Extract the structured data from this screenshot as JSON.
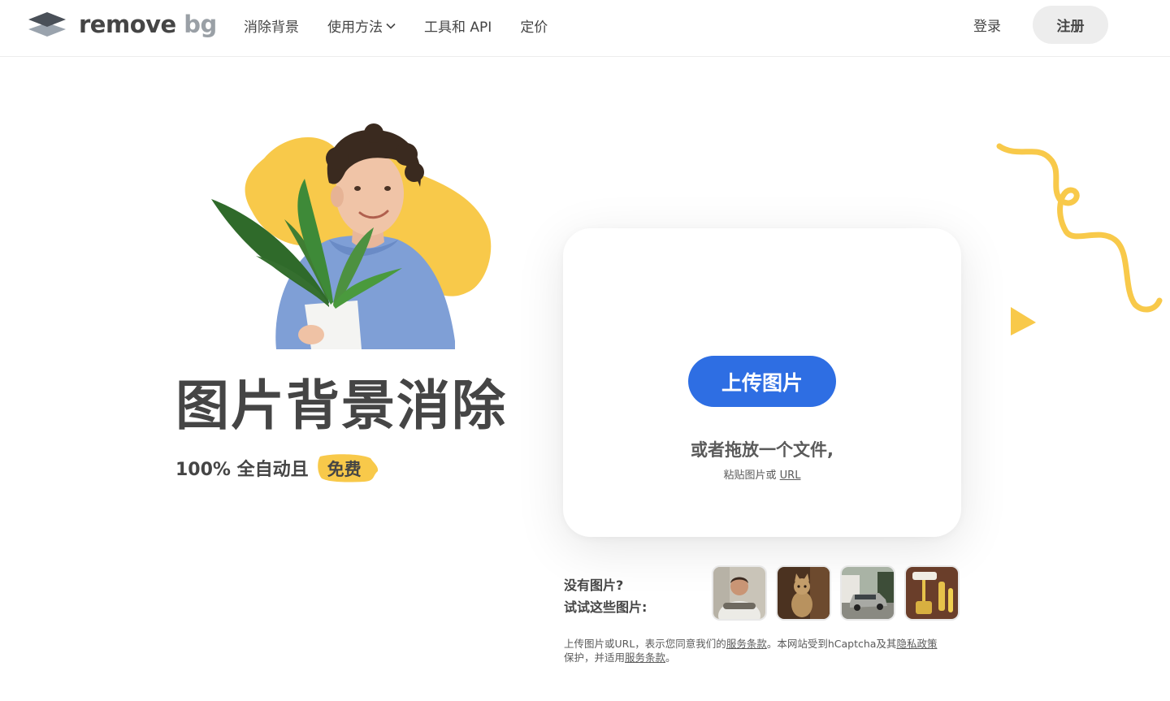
{
  "header": {
    "logo": {
      "text_main": "remove",
      "text_accent": "bg"
    },
    "nav": [
      {
        "label": "消除背景"
      },
      {
        "label": "使用方法",
        "has_dropdown": true
      },
      {
        "label": "工具和 API"
      },
      {
        "label": "定价"
      }
    ],
    "login_label": "登录",
    "signup_label": "注册"
  },
  "hero": {
    "title": "图片背景消除",
    "subtitle": "100% 全自动且",
    "badge": "免费"
  },
  "upload": {
    "button_label": "上传图片",
    "drop_text": "或者拖放一个文件,",
    "paste_text": "粘贴图片或",
    "url_link": "URL"
  },
  "samples": {
    "line1": "没有图片?",
    "line2": "试试这些图片:",
    "thumbnails": [
      {
        "icon": "sample-person-thumbnail"
      },
      {
        "icon": "sample-cat-thumbnail"
      },
      {
        "icon": "sample-car-thumbnail"
      },
      {
        "icon": "sample-paint-roller-thumbnail"
      }
    ]
  },
  "legal": {
    "part1": "上传图片或URL，表示您同意我们的",
    "terms_link_1": "服务条款",
    "part2": "。本网站受到hCaptcha及其",
    "privacy_link": "隐私政策",
    "part3": "保护，并适用",
    "terms_link_2": "服务条款",
    "part4": "。"
  },
  "colors": {
    "accent_blue": "#2e6ee3",
    "yellow": "#f8c94a",
    "text": "#454545"
  }
}
